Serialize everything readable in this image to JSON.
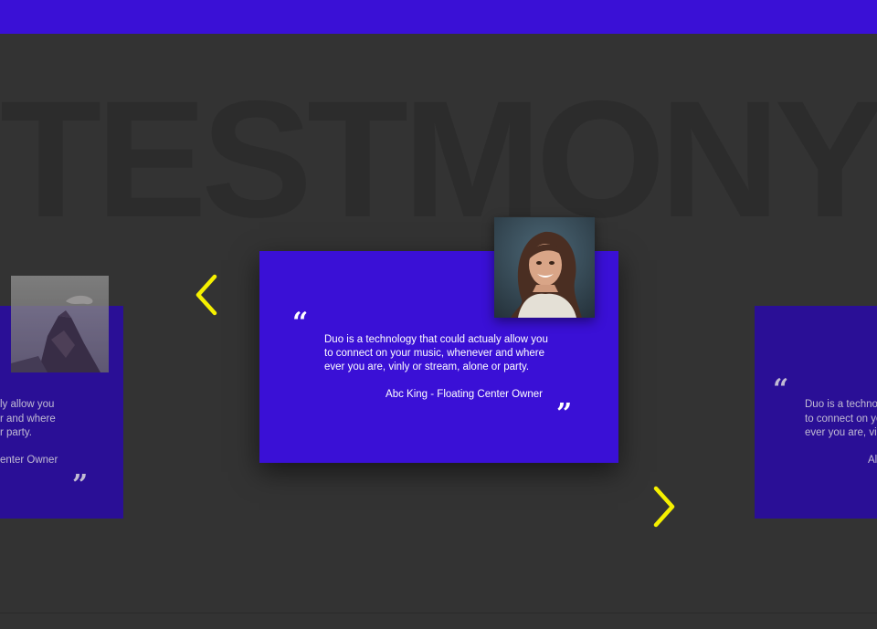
{
  "section": {
    "background_title": "TESTMONY"
  },
  "testimonials": [
    {
      "position": "left",
      "text_lines": [
        "ly allow you",
        "r and where",
        "r party."
      ],
      "author": "enter Owner",
      "photo": "mountain-peak-photo",
      "opacity": 0.75
    },
    {
      "position": "center",
      "text_lines": [
        "Duo is a technology that could actualy allow you",
        "to connect on your music, whenever and where",
        "ever you are, vinly or stream, alone or party."
      ],
      "author": "Abc King  - Floating Center Owner",
      "photo": "woman-portrait-photo"
    },
    {
      "position": "right",
      "text_lines": [
        "Duo is a techno",
        "to connect on yo",
        "ever you are, vin"
      ],
      "author": "Al",
      "opacity": 0.75
    }
  ],
  "quote_marks": {
    "open": "“",
    "close": "”"
  },
  "navigation": {
    "prev_icon": "chevron-left-icon",
    "next_icon": "chevron-right-icon"
  },
  "colors": {
    "accent_blue": "#3a10d6",
    "side_card_blue": "#2a0e9c",
    "background": "#333333",
    "arrow_yellow": "#f5f000",
    "watermark_text": "#2c2c2c"
  }
}
